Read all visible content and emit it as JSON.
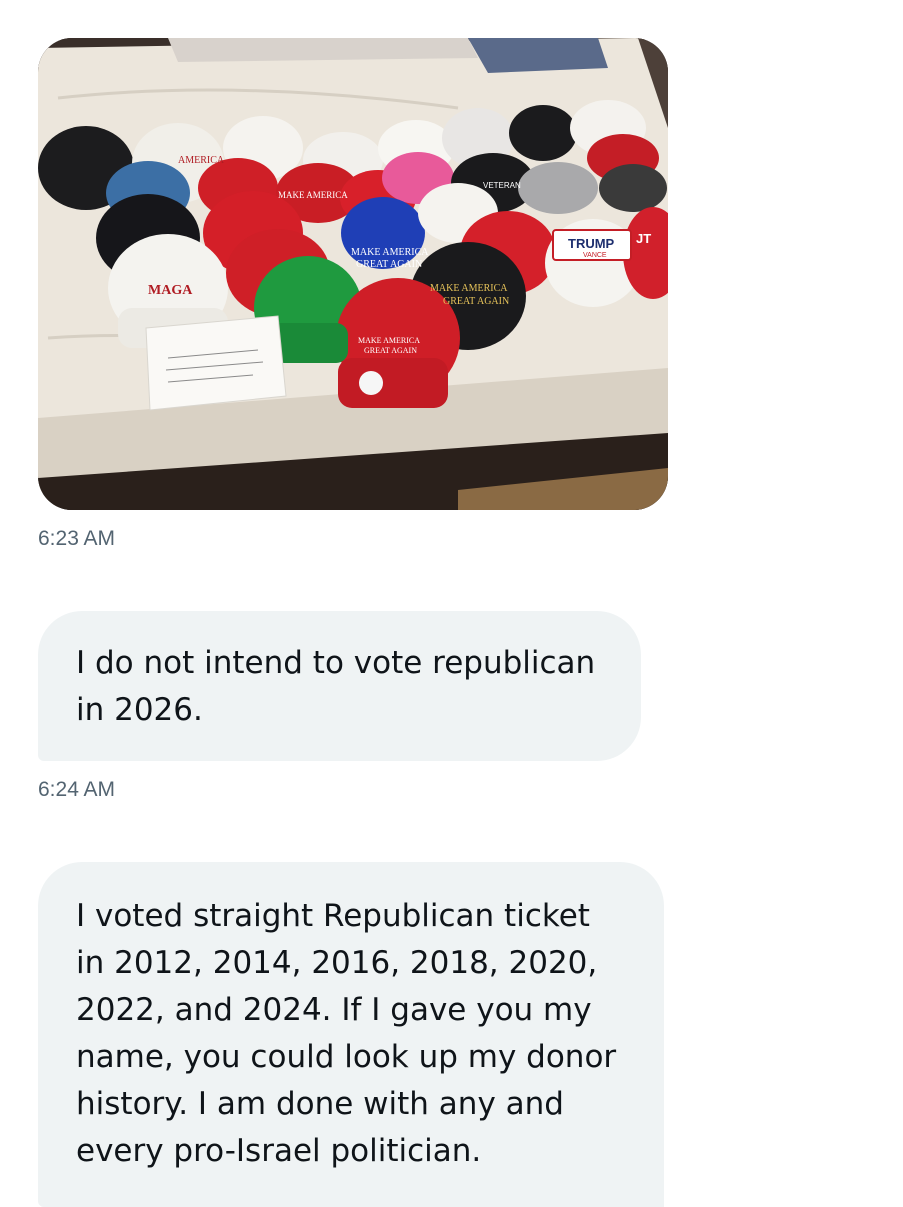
{
  "messages": [
    {
      "type": "image",
      "photo_alt": "Photo of many baseball caps laid out on a bed",
      "hat_texts": [
        "MAGA",
        "MAKE AMERICA GREAT AGAIN",
        "TRUMP",
        "VANCE",
        "VETERANS",
        "JT"
      ],
      "timestamp": "6:23 AM"
    },
    {
      "type": "text",
      "text": "I do not intend to vote republican\nin 2026.",
      "timestamp": "6:24 AM"
    },
    {
      "type": "text",
      "text": "I voted straight Republican ticket\nin 2012, 2014, 2016, 2018, 2020,\n2022, and 2024. If I gave you my\nname, you could look up my donor\nhistory. I am done with any and\nevery pro-Israel politician."
    }
  ],
  "colors": {
    "bubble_bg": "#eff3f4",
    "text": "#0f1419",
    "timestamp": "#536471"
  }
}
